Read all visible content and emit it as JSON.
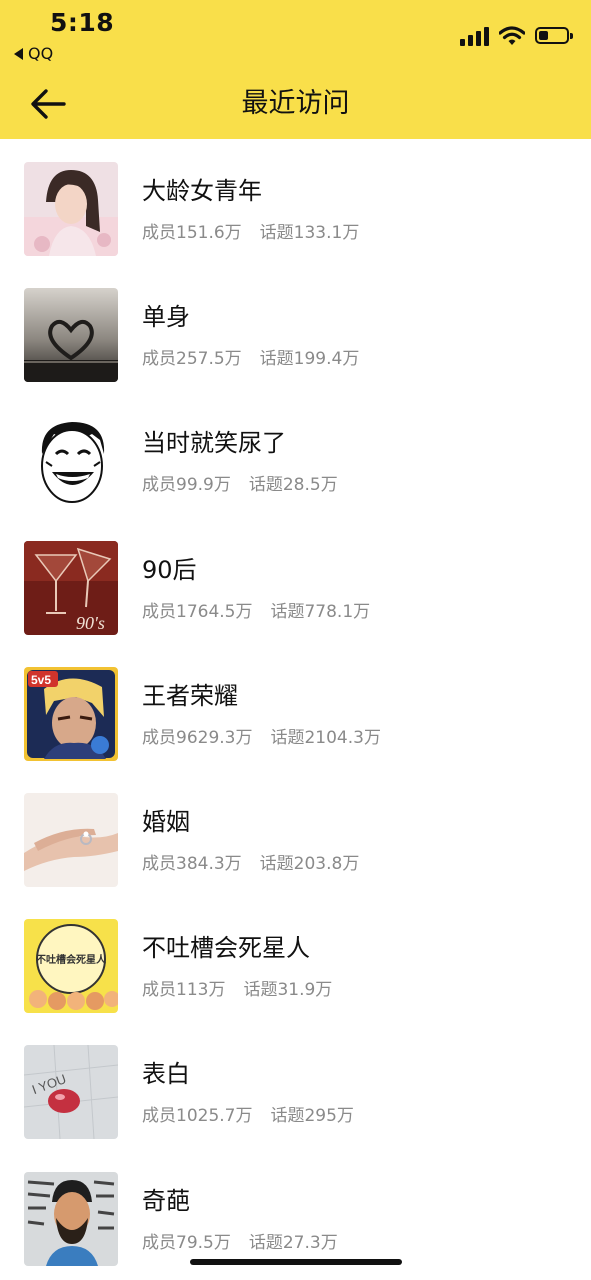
{
  "status_bar": {
    "time": "5:18",
    "back_app": "QQ"
  },
  "header": {
    "title": "最近访问"
  },
  "groups": [
    {
      "name": "大龄女青年",
      "members": "成员151.6万",
      "topics": "话题133.1万",
      "avatar_icon": "woman-portrait-icon"
    },
    {
      "name": "单身",
      "members": "成员257.5万",
      "topics": "话题199.4万",
      "avatar_icon": "book-heart-icon"
    },
    {
      "name": "当时就笑尿了",
      "members": "成员99.9万",
      "topics": "话题28.5万",
      "avatar_icon": "laughing-meme-face-icon"
    },
    {
      "name": "90后",
      "members": "成员1764.5万",
      "topics": "话题778.1万",
      "avatar_icon": "cocktail-glasses-icon",
      "avatar_text": "90's"
    },
    {
      "name": "王者荣耀",
      "members": "成员9629.3万",
      "topics": "话题2104.3万",
      "avatar_icon": "game-hero-icon",
      "avatar_text": "5v5"
    },
    {
      "name": "婚姻",
      "members": "成员384.3万",
      "topics": "话题203.8万",
      "avatar_icon": "ring-hand-icon"
    },
    {
      "name": "不吐槽会死星人",
      "members": "成员113万",
      "topics": "话题31.9万",
      "avatar_icon": "cartoon-crowd-icon",
      "avatar_text": "不吐槽会死星人"
    },
    {
      "name": "表白",
      "members": "成员1025.7万",
      "topics": "话题295万",
      "avatar_icon": "love-you-heart-icon",
      "avatar_text": "I YOU"
    },
    {
      "name": "奇葩",
      "members": "成员79.5万",
      "topics": "话题27.3万",
      "avatar_icon": "bearded-man-icon"
    }
  ]
}
